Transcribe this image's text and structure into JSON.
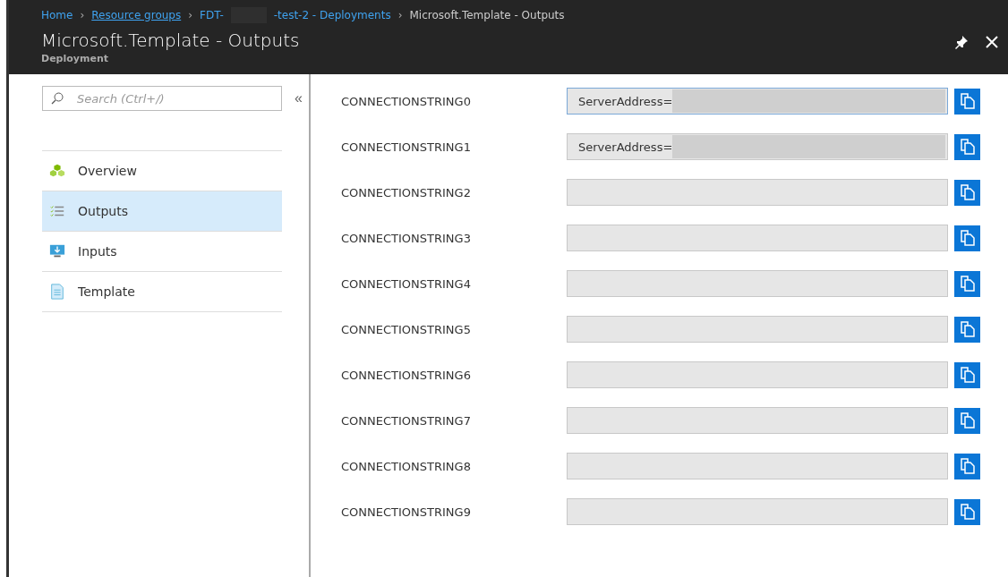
{
  "breadcrumb": [
    {
      "label": "Home",
      "kind": "link"
    },
    {
      "separator": "›",
      "label": "Resource groups",
      "kind": "link"
    },
    {
      "separator": "›",
      "label": "FDT-",
      "kind": "link"
    },
    {
      "kind": "redaction"
    },
    {
      "label": "-test-2 - Deployments",
      "kind": "link"
    },
    {
      "separator": "›",
      "label": "Microsoft.Template - Outputs",
      "kind": "current"
    }
  ],
  "blade": {
    "title": "Microsoft.Template - Outputs",
    "subtitle": "Deployment"
  },
  "sidebar": {
    "search": {
      "placeholder": "Search (Ctrl+/)"
    },
    "collapse": "«",
    "items": [
      {
        "label": "Overview",
        "kind": "overview",
        "selected": false
      },
      {
        "label": "Outputs",
        "kind": "outputs",
        "selected": true
      },
      {
        "label": "Inputs",
        "kind": "inputs",
        "selected": false
      },
      {
        "label": "Template",
        "kind": "template",
        "selected": false
      }
    ]
  },
  "outputs": [
    {
      "name": "CONNECTIONSTRING0",
      "value": "ServerAddress=",
      "redacted": true,
      "focused": true
    },
    {
      "name": "CONNECTIONSTRING1",
      "value": "ServerAddress=",
      "redacted": true,
      "focused": false
    },
    {
      "name": "CONNECTIONSTRING2",
      "redacted": false,
      "focused": false
    },
    {
      "name": "CONNECTIONSTRING3",
      "redacted": false,
      "focused": false
    },
    {
      "name": "CONNECTIONSTRING4",
      "redacted": false,
      "focused": false
    },
    {
      "name": "CONNECTIONSTRING5",
      "redacted": false,
      "focused": false
    },
    {
      "name": "CONNECTIONSTRING6",
      "redacted": false,
      "focused": false
    },
    {
      "name": "CONNECTIONSTRING7",
      "redacted": false,
      "focused": false
    },
    {
      "name": "CONNECTIONSTRING8",
      "redacted": false,
      "focused": false
    },
    {
      "name": "CONNECTIONSTRING9",
      "redacted": false,
      "focused": false
    }
  ]
}
